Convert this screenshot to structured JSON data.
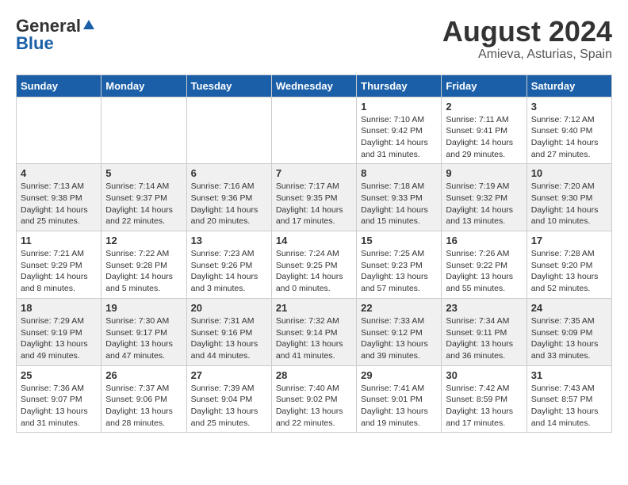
{
  "header": {
    "logo_line1": "General",
    "logo_line2": "Blue",
    "main_title": "August 2024",
    "subtitle": "Amieva, Asturias, Spain"
  },
  "calendar": {
    "days_of_week": [
      "Sunday",
      "Monday",
      "Tuesday",
      "Wednesday",
      "Thursday",
      "Friday",
      "Saturday"
    ],
    "weeks": [
      [
        {
          "day": "",
          "content": ""
        },
        {
          "day": "",
          "content": ""
        },
        {
          "day": "",
          "content": ""
        },
        {
          "day": "",
          "content": ""
        },
        {
          "day": "1",
          "content": "Sunrise: 7:10 AM\nSunset: 9:42 PM\nDaylight: 14 hours\nand 31 minutes."
        },
        {
          "day": "2",
          "content": "Sunrise: 7:11 AM\nSunset: 9:41 PM\nDaylight: 14 hours\nand 29 minutes."
        },
        {
          "day": "3",
          "content": "Sunrise: 7:12 AM\nSunset: 9:40 PM\nDaylight: 14 hours\nand 27 minutes."
        }
      ],
      [
        {
          "day": "4",
          "content": "Sunrise: 7:13 AM\nSunset: 9:38 PM\nDaylight: 14 hours\nand 25 minutes."
        },
        {
          "day": "5",
          "content": "Sunrise: 7:14 AM\nSunset: 9:37 PM\nDaylight: 14 hours\nand 22 minutes."
        },
        {
          "day": "6",
          "content": "Sunrise: 7:16 AM\nSunset: 9:36 PM\nDaylight: 14 hours\nand 20 minutes."
        },
        {
          "day": "7",
          "content": "Sunrise: 7:17 AM\nSunset: 9:35 PM\nDaylight: 14 hours\nand 17 minutes."
        },
        {
          "day": "8",
          "content": "Sunrise: 7:18 AM\nSunset: 9:33 PM\nDaylight: 14 hours\nand 15 minutes."
        },
        {
          "day": "9",
          "content": "Sunrise: 7:19 AM\nSunset: 9:32 PM\nDaylight: 14 hours\nand 13 minutes."
        },
        {
          "day": "10",
          "content": "Sunrise: 7:20 AM\nSunset: 9:30 PM\nDaylight: 14 hours\nand 10 minutes."
        }
      ],
      [
        {
          "day": "11",
          "content": "Sunrise: 7:21 AM\nSunset: 9:29 PM\nDaylight: 14 hours\nand 8 minutes."
        },
        {
          "day": "12",
          "content": "Sunrise: 7:22 AM\nSunset: 9:28 PM\nDaylight: 14 hours\nand 5 minutes."
        },
        {
          "day": "13",
          "content": "Sunrise: 7:23 AM\nSunset: 9:26 PM\nDaylight: 14 hours\nand 3 minutes."
        },
        {
          "day": "14",
          "content": "Sunrise: 7:24 AM\nSunset: 9:25 PM\nDaylight: 14 hours\nand 0 minutes."
        },
        {
          "day": "15",
          "content": "Sunrise: 7:25 AM\nSunset: 9:23 PM\nDaylight: 13 hours\nand 57 minutes."
        },
        {
          "day": "16",
          "content": "Sunrise: 7:26 AM\nSunset: 9:22 PM\nDaylight: 13 hours\nand 55 minutes."
        },
        {
          "day": "17",
          "content": "Sunrise: 7:28 AM\nSunset: 9:20 PM\nDaylight: 13 hours\nand 52 minutes."
        }
      ],
      [
        {
          "day": "18",
          "content": "Sunrise: 7:29 AM\nSunset: 9:19 PM\nDaylight: 13 hours\nand 49 minutes."
        },
        {
          "day": "19",
          "content": "Sunrise: 7:30 AM\nSunset: 9:17 PM\nDaylight: 13 hours\nand 47 minutes."
        },
        {
          "day": "20",
          "content": "Sunrise: 7:31 AM\nSunset: 9:16 PM\nDaylight: 13 hours\nand 44 minutes."
        },
        {
          "day": "21",
          "content": "Sunrise: 7:32 AM\nSunset: 9:14 PM\nDaylight: 13 hours\nand 41 minutes."
        },
        {
          "day": "22",
          "content": "Sunrise: 7:33 AM\nSunset: 9:12 PM\nDaylight: 13 hours\nand 39 minutes."
        },
        {
          "day": "23",
          "content": "Sunrise: 7:34 AM\nSunset: 9:11 PM\nDaylight: 13 hours\nand 36 minutes."
        },
        {
          "day": "24",
          "content": "Sunrise: 7:35 AM\nSunset: 9:09 PM\nDaylight: 13 hours\nand 33 minutes."
        }
      ],
      [
        {
          "day": "25",
          "content": "Sunrise: 7:36 AM\nSunset: 9:07 PM\nDaylight: 13 hours\nand 31 minutes."
        },
        {
          "day": "26",
          "content": "Sunrise: 7:37 AM\nSunset: 9:06 PM\nDaylight: 13 hours\nand 28 minutes."
        },
        {
          "day": "27",
          "content": "Sunrise: 7:39 AM\nSunset: 9:04 PM\nDaylight: 13 hours\nand 25 minutes."
        },
        {
          "day": "28",
          "content": "Sunrise: 7:40 AM\nSunset: 9:02 PM\nDaylight: 13 hours\nand 22 minutes."
        },
        {
          "day": "29",
          "content": "Sunrise: 7:41 AM\nSunset: 9:01 PM\nDaylight: 13 hours\nand 19 minutes."
        },
        {
          "day": "30",
          "content": "Sunrise: 7:42 AM\nSunset: 8:59 PM\nDaylight: 13 hours\nand 17 minutes."
        },
        {
          "day": "31",
          "content": "Sunrise: 7:43 AM\nSunset: 8:57 PM\nDaylight: 13 hours\nand 14 minutes."
        }
      ]
    ]
  }
}
